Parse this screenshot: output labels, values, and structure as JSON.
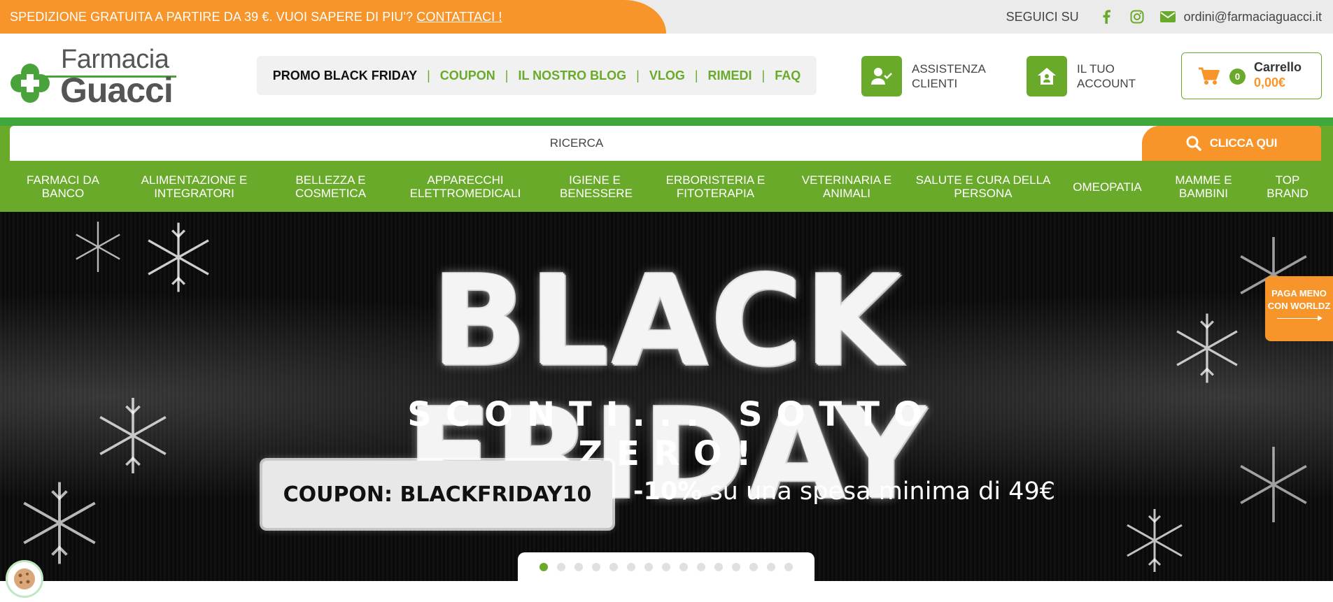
{
  "topbar": {
    "promo_text": "SPEDIZIONE GRATUITA A PARTIRE DA 39 €. VUOI SAPERE DI PIU'? ",
    "promo_link": "CONTATTACI !",
    "follow_label": "SEGUICI SU",
    "social_icons": [
      "facebook-icon",
      "instagram-icon",
      "mail-icon"
    ],
    "email": "ordini@farmaciaguacci.it"
  },
  "logo": {
    "line1": "Farmacia",
    "line2": "Guacci"
  },
  "menu": {
    "items": [
      "PROMO BLACK FRIDAY",
      "COUPON",
      "IL NOSTRO BLOG",
      "VLOG",
      "RIMEDI",
      "FAQ"
    ]
  },
  "header_buttons": {
    "assistance_line1": "ASSISTENZA",
    "assistance_line2": "CLIENTI",
    "account_line1": "IL TUO",
    "account_line2": "ACCOUNT"
  },
  "cart": {
    "count": "0",
    "label": "Carrello",
    "total": "0,00€"
  },
  "search": {
    "placeholder": "RICERCA",
    "button_label": "CLICCA QUI"
  },
  "categories": [
    {
      "l1": "FARMACI DA",
      "l2": "BANCO"
    },
    {
      "l1": "ALIMENTAZIONE E",
      "l2": "INTEGRATORI"
    },
    {
      "l1": "BELLEZZA E",
      "l2": "COSMETICA"
    },
    {
      "l1": "APPARECCHI",
      "l2": "ELETTROMEDICALI"
    },
    {
      "l1": "IGIENE E",
      "l2": "BENESSERE"
    },
    {
      "l1": "ERBORISTERIA E",
      "l2": "FITOTERAPIA"
    },
    {
      "l1": "VETERINARIA E",
      "l2": "ANIMALI"
    },
    {
      "l1": "SALUTE E CURA DELLA",
      "l2": "PERSONA"
    },
    {
      "l1": "OMEOPATIA",
      "l2": ""
    },
    {
      "l1": "MAMME E",
      "l2": "BAMBINI"
    },
    {
      "l1": "TOP",
      "l2": "BRAND"
    }
  ],
  "hero": {
    "title": "BLACK FRIDAY",
    "subtitle": "SCONTI... SOTTO ZERO!",
    "coupon": "COUPON: BLACKFRIDAY10",
    "discount_bold": "-10%",
    "discount_text": " su una spesa minima di 49€",
    "slide_count": 15,
    "active_slide": 1
  },
  "worldz": {
    "line1": "PAGA MENO",
    "line2": "CON WORLDZ"
  },
  "colors": {
    "green": "#6aaa2a",
    "orange": "#f7952a",
    "dark": "#0d0d0d"
  }
}
